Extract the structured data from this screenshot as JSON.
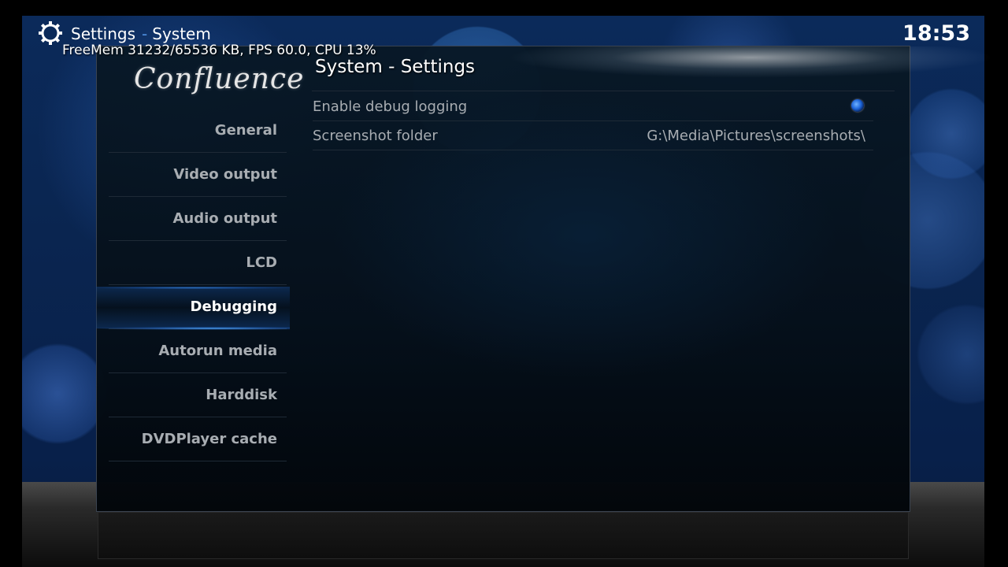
{
  "header": {
    "section": "Settings",
    "separator": "-",
    "subsection": "System",
    "icon": "gear-icon",
    "clock": "18:53",
    "debug_info": "FreeMem 31232/65536 KB, FPS 60.0, CPU 13%"
  },
  "logo": {
    "text": "Confluence"
  },
  "sidebar": {
    "items": [
      {
        "label": "General",
        "active": false
      },
      {
        "label": "Video output",
        "active": false
      },
      {
        "label": "Audio output",
        "active": false
      },
      {
        "label": "LCD",
        "active": false
      },
      {
        "label": "Debugging",
        "active": true
      },
      {
        "label": "Autorun media",
        "active": false
      },
      {
        "label": "Harddisk",
        "active": false
      },
      {
        "label": "DVDPlayer cache",
        "active": false
      }
    ]
  },
  "content": {
    "title": "System - Settings",
    "settings": [
      {
        "label": "Enable debug logging",
        "type": "radio",
        "checked": true
      },
      {
        "label": "Screenshot folder",
        "type": "path",
        "value": "G:\\Media\\Pictures\\screenshots\\"
      }
    ]
  },
  "colors": {
    "accent": "#4f8fe0",
    "active_glow": "#50aaff",
    "inactive_text": "#a8adb2"
  }
}
